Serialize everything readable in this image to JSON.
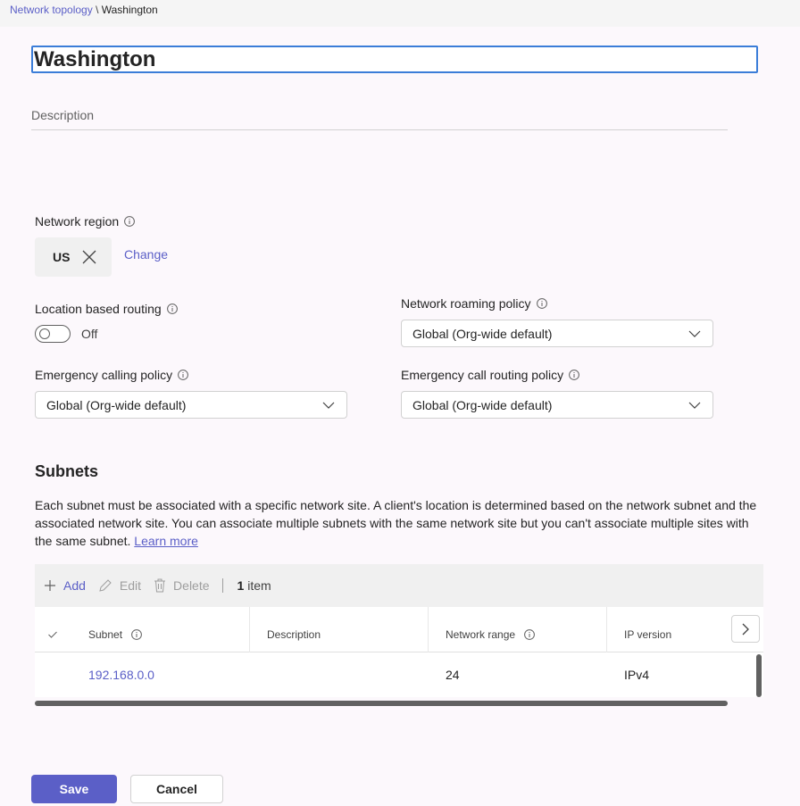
{
  "breadcrumb": {
    "parent": "Network topology",
    "separator": "\\",
    "current": "Washington"
  },
  "site": {
    "name": "Washington",
    "description_placeholder": "Description"
  },
  "network_region": {
    "label": "Network region",
    "value": "US",
    "change_label": "Change"
  },
  "location_routing": {
    "label": "Location based routing",
    "state": "Off"
  },
  "roaming_policy": {
    "label": "Network roaming policy",
    "value": "Global (Org-wide default)"
  },
  "emergency_calling": {
    "label": "Emergency calling policy",
    "value": "Global (Org-wide default)"
  },
  "emergency_routing": {
    "label": "Emergency call routing policy",
    "value": "Global (Org-wide default)"
  },
  "subnets": {
    "title": "Subnets",
    "description": "Each subnet must be associated with a specific network site. A client's location is determined based on the network subnet and the associated network site. You can associate multiple subnets with the same network site but you can't associate multiple sites with the same subnet.",
    "learn_more": "Learn more",
    "toolbar": {
      "add": "Add",
      "edit": "Edit",
      "delete": "Delete",
      "count_number": "1",
      "count_label": "item"
    },
    "columns": {
      "subnet": "Subnet",
      "description": "Description",
      "network_range": "Network range",
      "ip_version": "IP version"
    },
    "rows": [
      {
        "subnet": "192.168.0.0",
        "description": "",
        "network_range": "24",
        "ip_version": "IPv4"
      }
    ]
  },
  "actions": {
    "save": "Save",
    "cancel": "Cancel"
  },
  "colors": {
    "accent": "#5b5fc7",
    "focus_border": "#3b7dd8"
  }
}
